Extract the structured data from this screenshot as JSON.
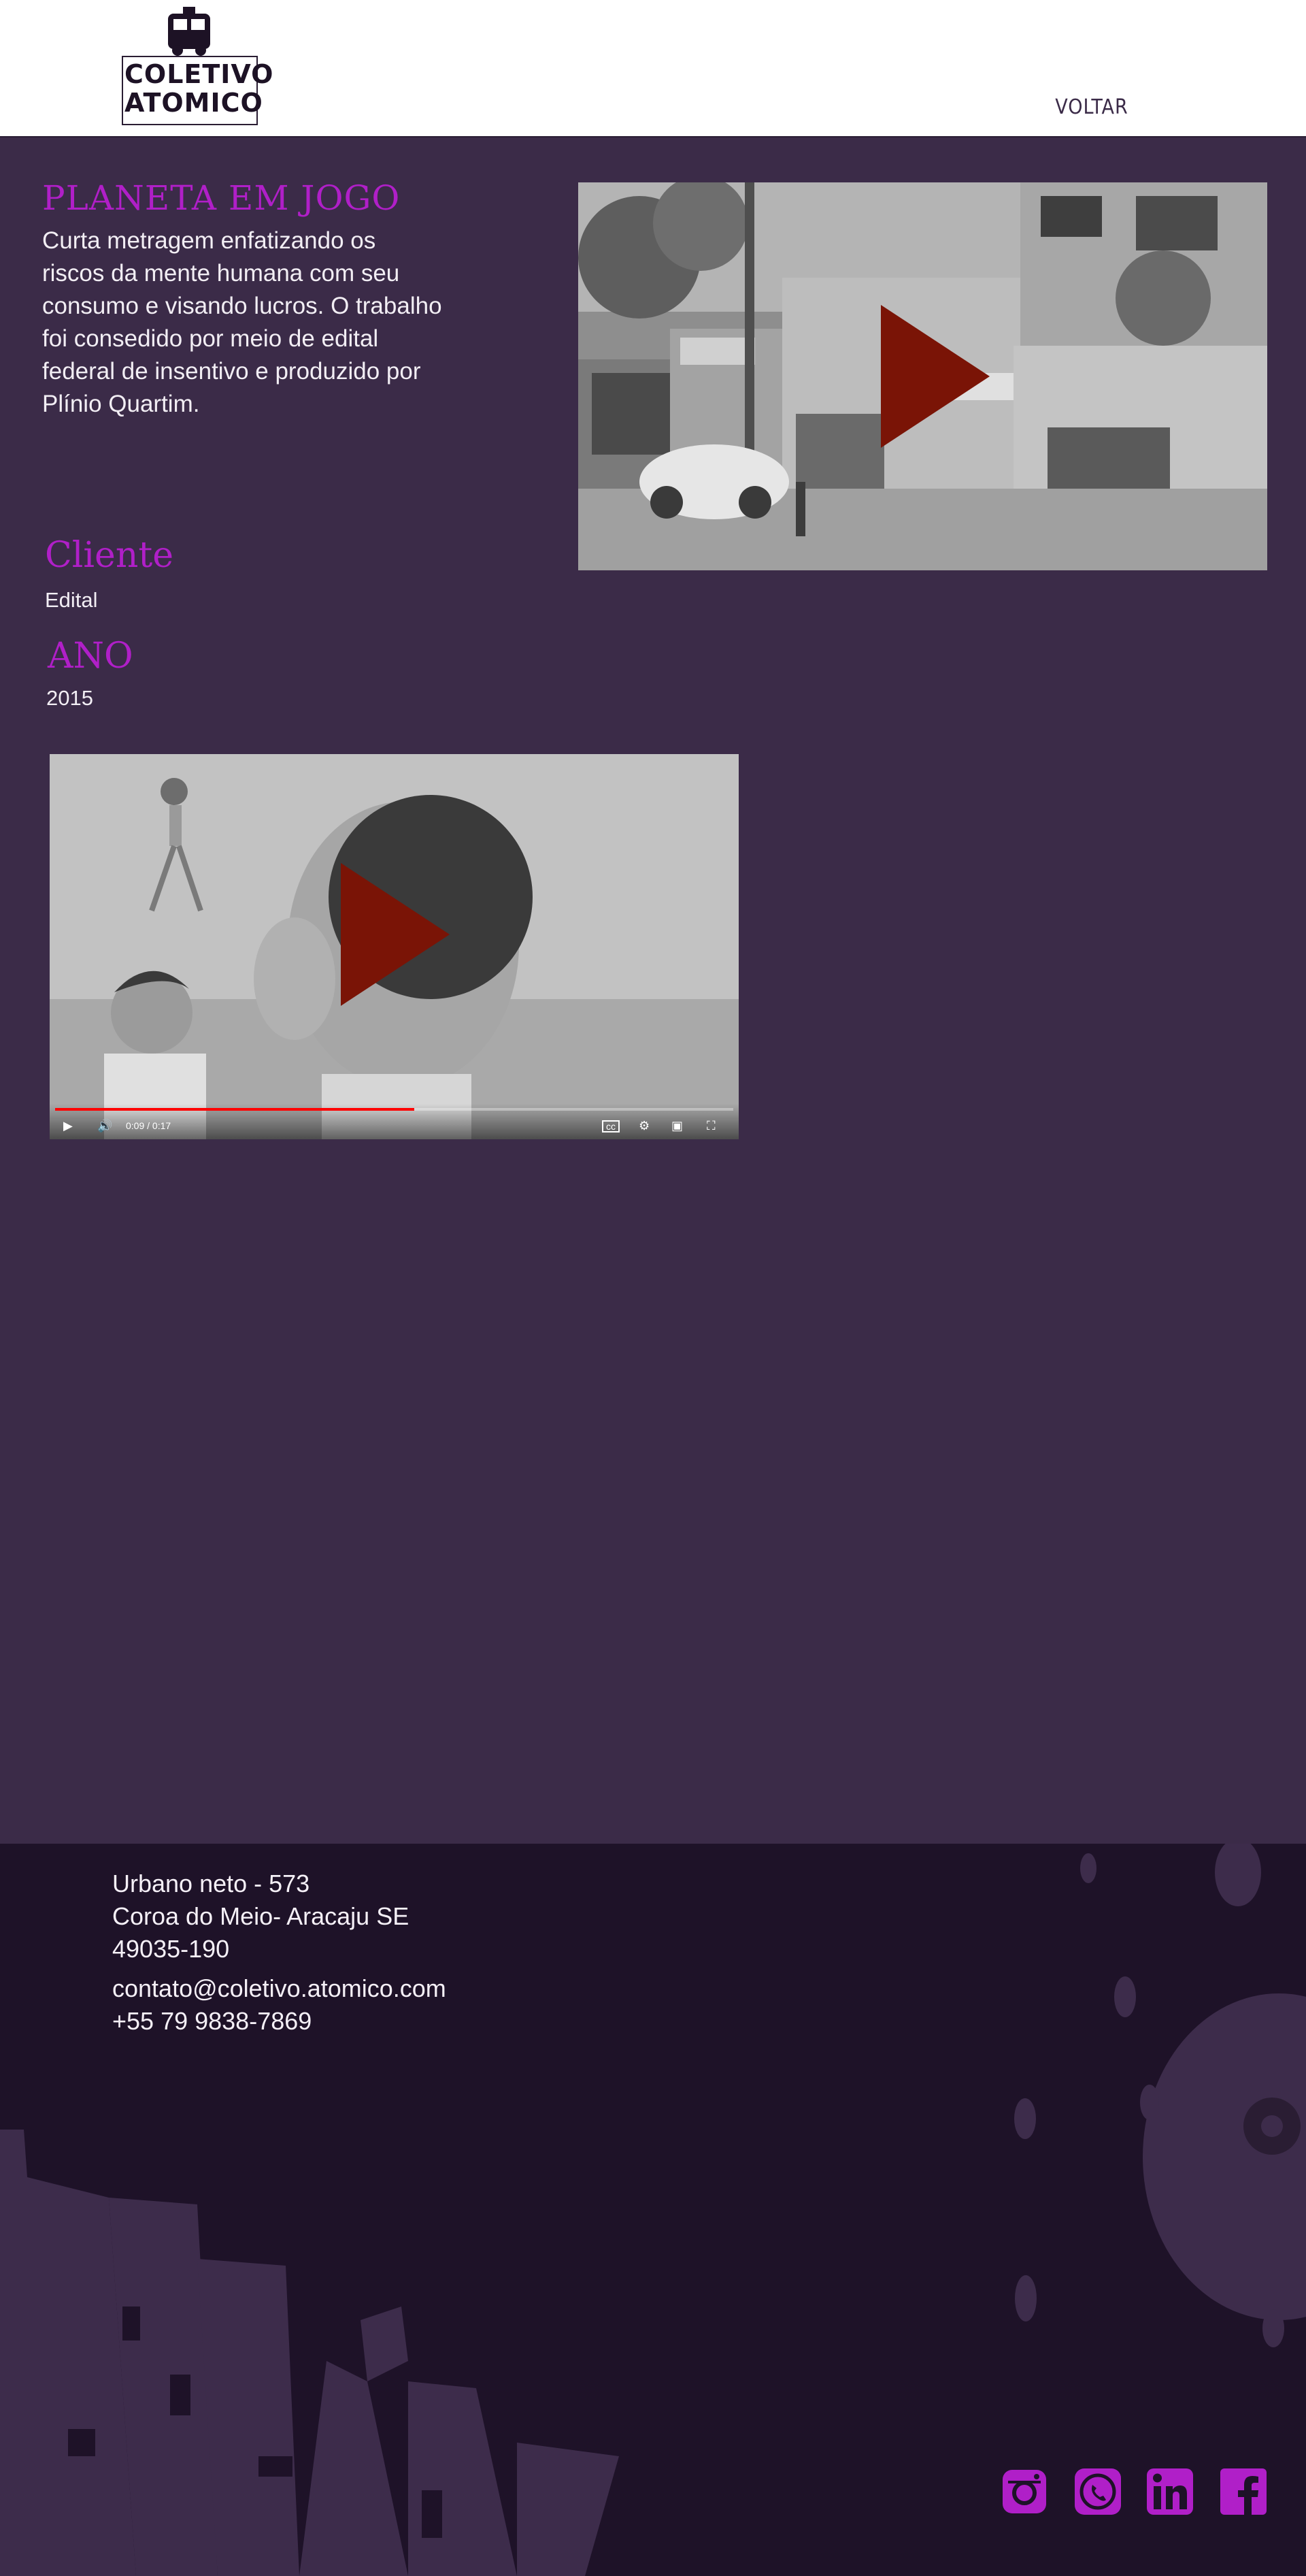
{
  "header": {
    "logo_alt": "Coletivo Atomico",
    "logo_text_1": "COLETIVO",
    "logo_text_2": "ATOMICO",
    "back_link": "VOLTAR"
  },
  "project": {
    "title": "PLANETA EM JOGO",
    "description": "Curta metragem enfatizando os riscos da mente humana com seu consumo e visando lucros. O trabalho foi consedido por meio de edital federal de insentivo e produzido por Plínio Quartim.",
    "client_label": "Cliente",
    "client_value": "Edital",
    "year_label": "ANO",
    "year_value": "2015"
  },
  "videos": {
    "top": {
      "name": "street-illustration-video"
    },
    "main": {
      "time": "0:09 / 0:17",
      "progress": 0.53
    }
  },
  "footer": {
    "address_line1": "Urbano neto - 573",
    "address_line2": "Coroa do Meio- Aracaju SE",
    "address_line3": "49035-190",
    "email": "contato@coletivo.atomico.com",
    "phone": "+55 79 9838-7869",
    "social": [
      "instagram-icon",
      "whatsapp-icon",
      "linkedin-icon",
      "facebook-icon"
    ]
  },
  "colors": {
    "page_bg": "#3b2b48",
    "accent": "#b01fc8",
    "footer_bg": "#1e1228",
    "play_button": "#7a1406"
  }
}
